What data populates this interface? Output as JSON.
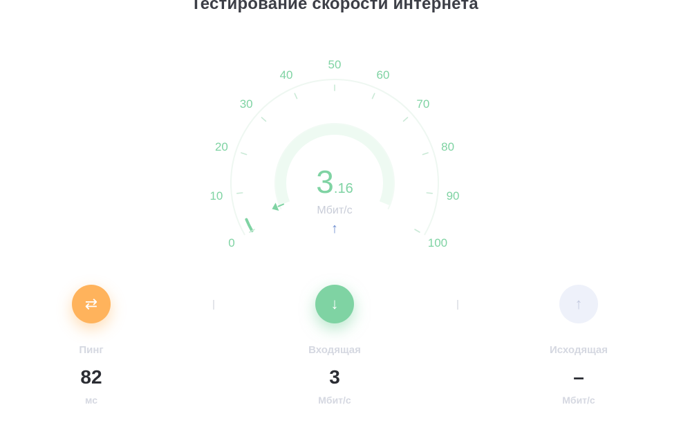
{
  "page": {
    "title": "Тестирование скорости интернета"
  },
  "gauge": {
    "min": 0,
    "max": 100,
    "scale_labels": [
      "0",
      "10",
      "20",
      "30",
      "40",
      "50",
      "60",
      "70",
      "80",
      "90",
      "100"
    ],
    "current_value": 3.16,
    "value_integer": "3",
    "value_decimal": ".16",
    "unit": "Мбит/с",
    "direction_icon": "arrow-up-icon",
    "accent_color": "#7fd3a3"
  },
  "stats": {
    "ping": {
      "icon": "swap-arrows-icon",
      "icon_glyph": "⇄",
      "label": "Пинг",
      "value": "82",
      "unit": "мс",
      "color": "#ffb35c"
    },
    "download": {
      "icon": "arrow-down-icon",
      "icon_glyph": "↓",
      "label": "Входящая",
      "value": "3",
      "unit": "Мбит/с",
      "color": "#7fd3a3"
    },
    "upload": {
      "icon": "arrow-up-icon",
      "icon_glyph": "↑",
      "label": "Исходящая",
      "value": "–",
      "unit": "Мбит/с",
      "color": "#eef1fa"
    }
  }
}
